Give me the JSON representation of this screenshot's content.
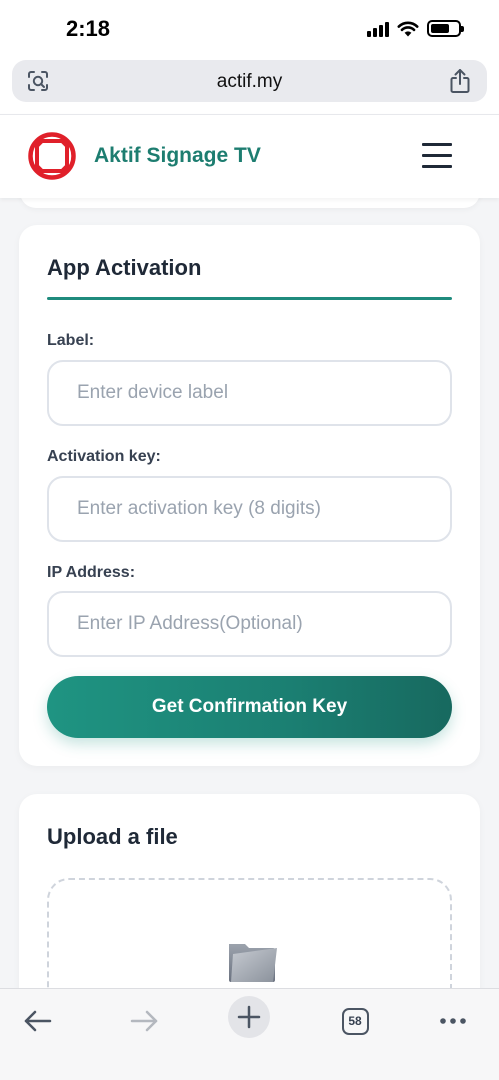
{
  "status_bar": {
    "time": "2:18"
  },
  "browser": {
    "url": "actif.my",
    "tab_count": "58"
  },
  "header": {
    "brand": "Aktif Signage TV",
    "brand_color": "#1d7d70"
  },
  "activation": {
    "title": "App Activation",
    "fields": [
      {
        "label": "Label:",
        "placeholder": "Enter device label",
        "value": ""
      },
      {
        "label": "Activation key:",
        "placeholder": "Enter activation key (8 digits)",
        "value": ""
      },
      {
        "label": "IP Address:",
        "placeholder": "Enter IP Address(Optional)",
        "value": ""
      }
    ],
    "button_label": "Get Confirmation Key",
    "accent_color": "#1f8b7d"
  },
  "upload": {
    "title": "Upload a file",
    "icon": "folder-icon"
  },
  "toolbar": {
    "icons": [
      "back-arrow-icon",
      "forward-arrow-icon",
      "plus-icon",
      "tabs-icon",
      "more-icon"
    ]
  }
}
